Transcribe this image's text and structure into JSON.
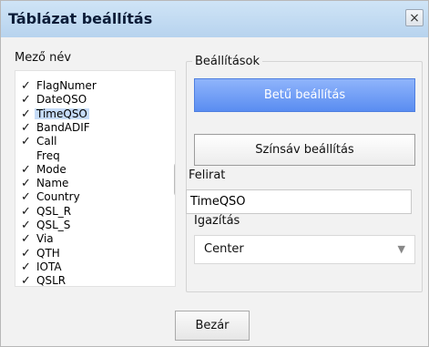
{
  "dialog": {
    "title": "Táblázat beállítás",
    "close_label": "×"
  },
  "field_list": {
    "label": "Mező név",
    "items": [
      {
        "label": "FlagNumer",
        "checked": true
      },
      {
        "label": "DateQSO",
        "checked": true
      },
      {
        "label": "TimeQSO",
        "checked": true,
        "selected": true
      },
      {
        "label": "BandADIF",
        "checked": true
      },
      {
        "label": "Call",
        "checked": true
      },
      {
        "label": "Freq",
        "checked": false
      },
      {
        "label": "Mode",
        "checked": true
      },
      {
        "label": "Name",
        "checked": true
      },
      {
        "label": "Country",
        "checked": true
      },
      {
        "label": "QSL_R",
        "checked": true
      },
      {
        "label": "QSL_S",
        "checked": true
      },
      {
        "label": "Via",
        "checked": true
      },
      {
        "label": "QTH",
        "checked": true
      },
      {
        "label": "IOTA",
        "checked": true
      },
      {
        "label": "QSLR",
        "checked": true
      }
    ],
    "scroll_up": "▲",
    "scroll_down": "▼"
  },
  "settings": {
    "group_title": "Beállítások",
    "font_button": "Betű beállítás",
    "color_button": "Színsáv beállítás",
    "caption_label": "Felirat",
    "caption_value": "TimeQSO",
    "align_label": "Igazítás",
    "align_value": "Center",
    "align_arrow": "▼"
  },
  "footer": {
    "close_button": "Bezár"
  }
}
